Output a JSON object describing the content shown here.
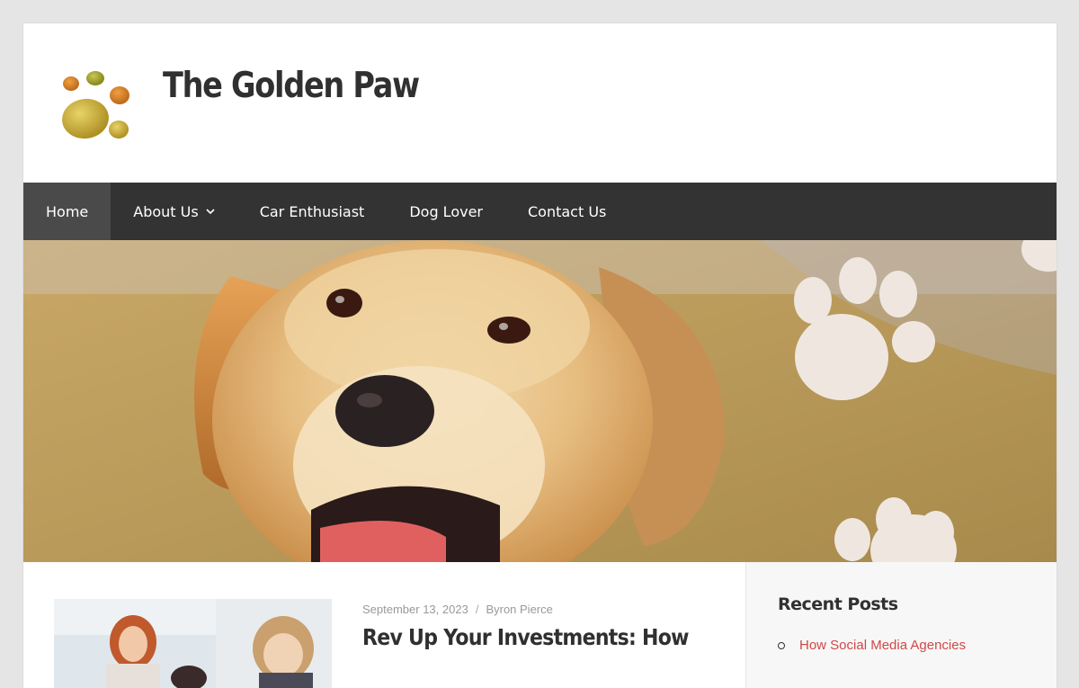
{
  "site": {
    "title": "The Golden Paw"
  },
  "nav": {
    "items": [
      {
        "label": "Home",
        "active": true
      },
      {
        "label": "About Us",
        "has_dropdown": true
      },
      {
        "label": "Car Enthusiast"
      },
      {
        "label": "Dog Lover"
      },
      {
        "label": "Contact Us"
      }
    ]
  },
  "post": {
    "date": "September 13, 2023",
    "separator": "/",
    "author": "Byron Pierce",
    "title": "Rev Up Your Investments: How"
  },
  "sidebar": {
    "widget_title": "Recent Posts",
    "recent_posts": [
      "How Social Media Agencies"
    ]
  },
  "colors": {
    "nav_bg": "#333333",
    "nav_active_bg": "#4a4a4a",
    "link_red": "#d04848",
    "page_bg": "#e5e5e5"
  },
  "icons": {
    "logo": "paw-print-logo",
    "dropdown": "chevron-down-icon",
    "list_bullet": "circle-bullet"
  }
}
